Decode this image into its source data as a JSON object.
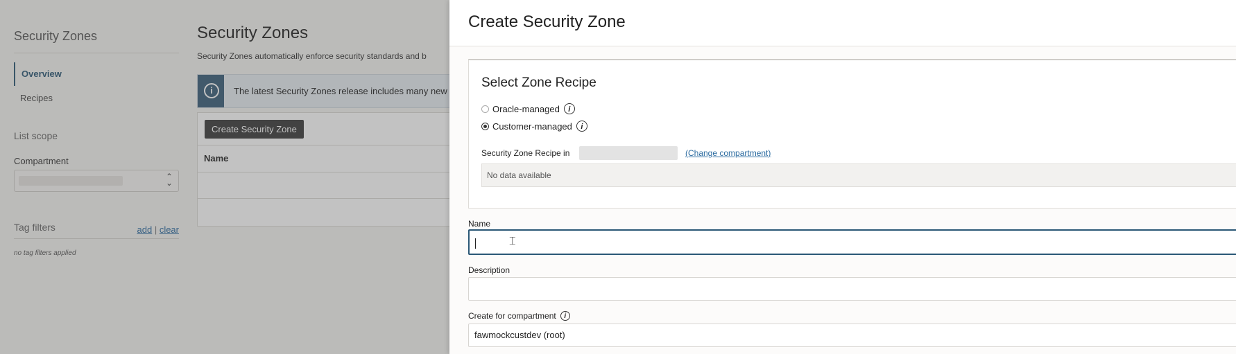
{
  "sidebar": {
    "title": "Security Zones",
    "items": [
      {
        "label": "Overview"
      },
      {
        "label": "Recipes"
      }
    ],
    "list_scope_label": "List scope",
    "compartment_label": "Compartment",
    "compartment_value": "",
    "tag_filters_label": "Tag filters",
    "tag_add": "add",
    "tag_sep": " | ",
    "tag_clear": "clear",
    "no_tag_filters": "no tag filters applied"
  },
  "main": {
    "title": "Security Zones",
    "description": "Security Zones automatically enforce security standards and b",
    "banner_text": "The latest Security Zones release includes many new",
    "create_button": "Create Security Zone",
    "table_header_name": "Name"
  },
  "panel": {
    "title": "Create Security Zone",
    "recipe_section_title": "Select Zone Recipe",
    "radio_oracle": "Oracle-managed",
    "radio_customer": "Customer-managed",
    "selected_option": "Customer-managed",
    "recipe_in_label": "Security Zone Recipe in",
    "change_compartment": "(Change compartment)",
    "no_data": "No data available",
    "name_label": "Name",
    "name_value": "",
    "description_label": "Description",
    "description_value": "",
    "create_for_label": "Create for compartment",
    "create_for_value": "fawmockcustdev (root)"
  },
  "icons": {
    "info": "info-icon",
    "select_chevron": "chevron-updown-icon",
    "text_cursor": "ibeam-cursor-icon"
  },
  "colors": {
    "accent": "#2b5876",
    "link": "#2b6ba0",
    "banner_bar": "#3a5e7a",
    "button_bg": "#3b3b3b"
  }
}
